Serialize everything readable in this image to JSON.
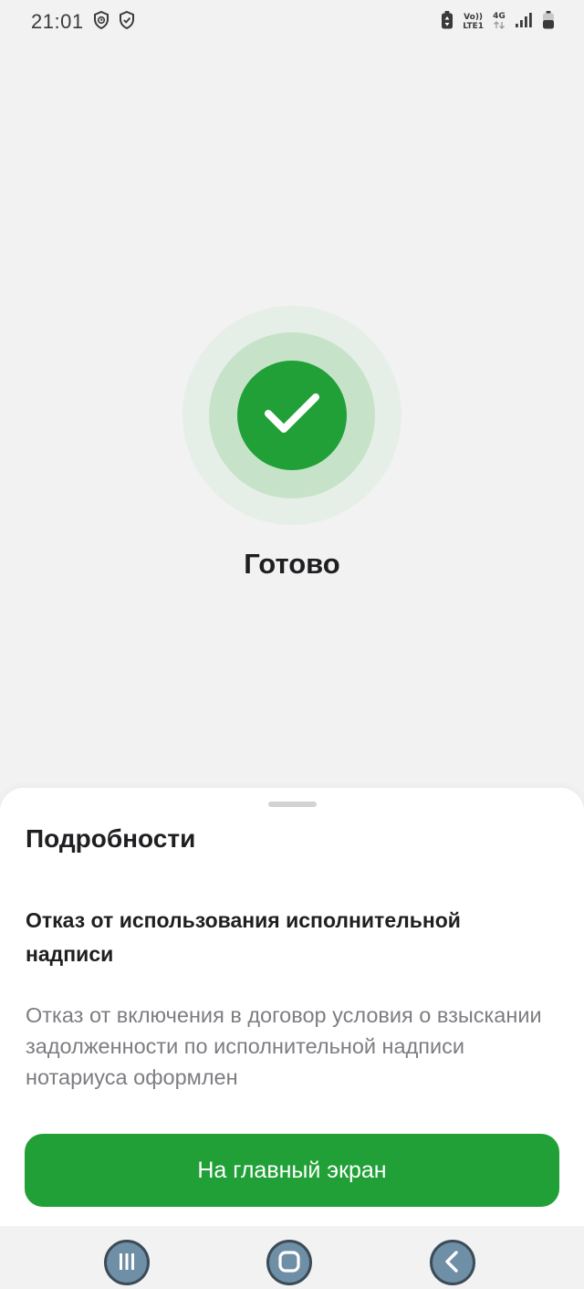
{
  "status_bar": {
    "time": "21:01",
    "network_top": "Vo))",
    "network_bottom": "LTE1",
    "network_type": "4G",
    "icons": [
      "shield-clock-icon",
      "shield-check-icon",
      "battery-saver-icon",
      "signal-icon",
      "battery-icon"
    ]
  },
  "result": {
    "title": "Готово",
    "icon": "check-icon",
    "accent_color": "#21a038"
  },
  "sheet": {
    "details_title": "Подробности",
    "operation_title": "Отказ от использования исполнительной надписи",
    "operation_description": "Отказ от включения в договор условия о взыскании задолженности по исполнительной надписи нотариуса оформлен",
    "primary_button": "На главный экран"
  },
  "nav_bar": {
    "buttons": [
      "recents-icon",
      "home-icon",
      "back-icon"
    ]
  }
}
